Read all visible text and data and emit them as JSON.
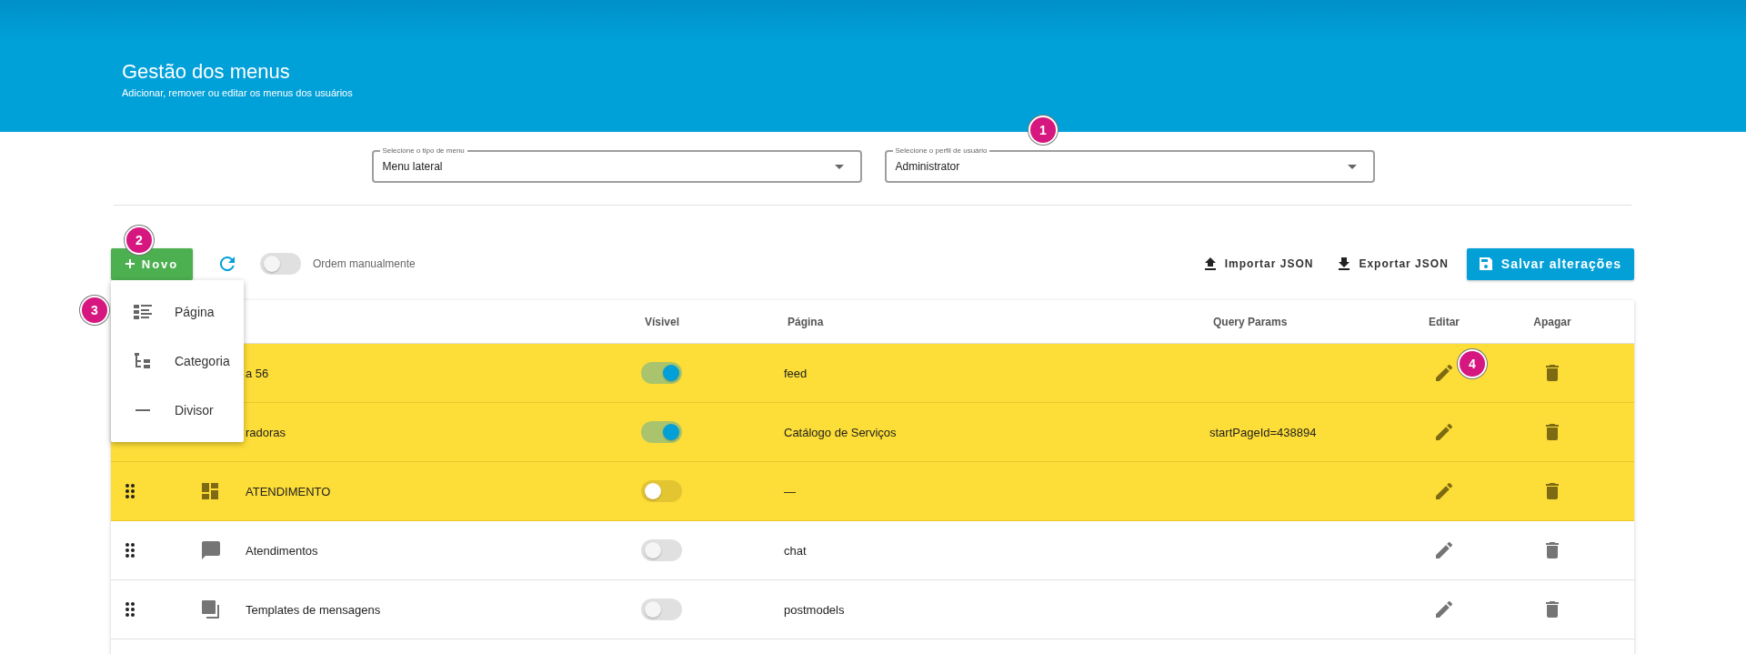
{
  "header": {
    "title": "Gestão dos menus",
    "subtitle": "Adicionar, remover ou editar os menus dos usuários"
  },
  "filters": [
    {
      "label": "Selecione o tipo de menu",
      "value": "Menu lateral"
    },
    {
      "label": "Selecione o perfil de usuário",
      "value": "Administrator"
    }
  ],
  "toolbar": {
    "new_button": "Novo",
    "manual_order": {
      "label": "Ordem manualmente",
      "on": false
    },
    "import_button": "Importar JSON",
    "export_button": "Exportar JSON",
    "save_button": "Salvar alterações"
  },
  "new_menu": {
    "items": [
      {
        "label": "Página",
        "kind": "list"
      },
      {
        "label": "Categoria",
        "kind": "tree"
      },
      {
        "label": "Divisor",
        "kind": "line"
      }
    ]
  },
  "table": {
    "columns": [
      "Vísivel",
      "Página",
      "Query Params",
      "Editar",
      "Apagar"
    ],
    "rows": [
      {
        "name": "a 56",
        "kind": "covered",
        "visible": true,
        "page": "feed",
        "query": "",
        "highlighted": true
      },
      {
        "name": "radoras",
        "kind": "covered",
        "visible": true,
        "page": "Catálogo de Serviços",
        "query": "startPageId=438894",
        "highlighted": true
      },
      {
        "name": "ATENDIMENTO",
        "kind": "dashboard",
        "visible": false,
        "page": "—",
        "query": "",
        "highlighted": true
      },
      {
        "name": "Atendimentos",
        "kind": "chat",
        "visible": false,
        "page": "chat",
        "query": "",
        "highlighted": false
      },
      {
        "name": "Templates de mensagens",
        "kind": "copy",
        "visible": false,
        "page": "postmodels",
        "query": "",
        "highlighted": false
      }
    ]
  },
  "callouts": [
    {
      "number": "1"
    },
    {
      "number": "2"
    },
    {
      "number": "3"
    },
    {
      "number": "4"
    }
  ]
}
